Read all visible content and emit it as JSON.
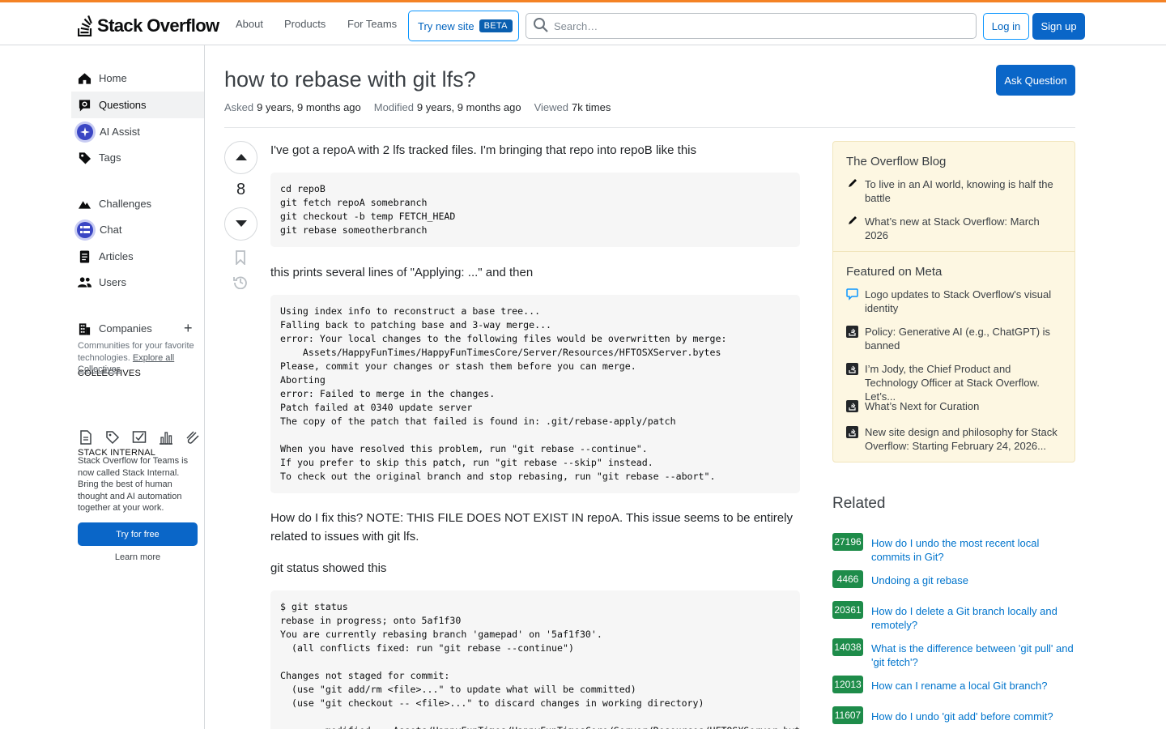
{
  "header": {
    "logo_text": "Stack Overflow",
    "nav": [
      "About",
      "Products",
      "For Teams"
    ],
    "try_new_label": "Try new site",
    "beta_label": "BETA",
    "search_placeholder": "Search…",
    "login_label": "Log in",
    "signup_label": "Sign up"
  },
  "sidebar": {
    "items": [
      {
        "label": "Home",
        "icon": "home-icon"
      },
      {
        "label": "Questions",
        "icon": "questions-icon",
        "active": true
      },
      {
        "label": "AI Assist",
        "icon": "ai-assist-icon"
      },
      {
        "label": "Tags",
        "icon": "tag-icon"
      },
      {
        "label": "Challenges",
        "icon": "challenges-icon"
      },
      {
        "label": "Chat",
        "icon": "chat-icon"
      },
      {
        "label": "Articles",
        "icon": "articles-icon"
      },
      {
        "label": "Users",
        "icon": "users-icon"
      },
      {
        "label": "Companies",
        "icon": "companies-icon"
      }
    ],
    "collectives_title": "COLLECTIVES",
    "collectives_desc": "Communities for your favorite technologies.",
    "collectives_link": "Explore all Collectives",
    "stack_internal_title": "STACK INTERNAL",
    "stack_internal_desc": "Stack Overflow for Teams is now called Stack Internal. Bring the best of human thought and AI automation together at your work.",
    "try_free_label": "Try for free",
    "learn_more_label": "Learn more"
  },
  "question": {
    "title": "how to rebase with git lfs?",
    "asked_label": "Asked",
    "asked_value": "9 years, 9 months ago",
    "modified_label": "Modified",
    "modified_value": "9 years, 9 months ago",
    "viewed_label": "Viewed",
    "viewed_value": "7k times",
    "ask_button": "Ask Question",
    "votes": "8",
    "p1": "I've got a repoA with 2 lfs tracked files. I'm bringing that repo into repoB like this",
    "code1": "cd repoB\ngit fetch repoA somebranch\ngit checkout -b temp FETCH_HEAD\ngit rebase someotherbranch",
    "p2": "this prints several lines of \"Applying: ...\" and then",
    "code2": "Using index info to reconstruct a base tree...\nFalling back to patching base and 3-way merge...\nerror: Your local changes to the following files would be overwritten by merge:\n    Assets/HappyFunTimes/HappyFunTimesCore/Server/Resources/HFTOSXServer.bytes\nPlease, commit your changes or stash them before you can merge.\nAborting\nerror: Failed to merge in the changes.\nPatch failed at 0340 update server\nThe copy of the patch that failed is found in: .git/rebase-apply/patch\n\nWhen you have resolved this problem, run \"git rebase --continue\".\nIf you prefer to skip this patch, run \"git rebase --skip\" instead.\nTo check out the original branch and stop rebasing, run \"git rebase --abort\".",
    "p3": "How do I fix this? NOTE: THIS FILE DOES NOT EXIST IN repoA. This issue seems to be entirely related to issues with git lfs.",
    "p4": "git status showed this",
    "code3": "$ git status\nrebase in progress; onto 5af1f30\nYou are currently rebasing branch 'gamepad' on '5af1f30'.\n  (all conflicts fixed: run \"git rebase --continue\")\n\nChanges not staged for commit:\n  (use \"git add/rm <file>...\" to update what will be committed)\n  (use \"git checkout -- <file>...\" to discard changes in working directory)\n\n        modified:   Assets/HappyFunTimes/HappyFunTimesCore/Server/Resources/HFTOSXServer.bytes"
  },
  "blog": {
    "title": "The Overflow Blog",
    "items": [
      "To live in an AI world, knowing is half the battle",
      "What’s new at Stack Overflow: March 2026"
    ]
  },
  "meta": {
    "title": "Featured on Meta",
    "items": [
      "Logo updates to Stack Overflow's visual identity",
      "Policy: Generative AI (e.g., ChatGPT) is banned",
      "I’m Jody, the Chief Product and Technology Officer at Stack Overflow. Let’s...",
      "What’s Next for Curation",
      "New site design and philosophy for Stack Overflow: Starting February 24, 2026..."
    ]
  },
  "related": {
    "title": "Related",
    "items": [
      {
        "score": "27196",
        "text": "How do I undo the most recent local commits in Git?"
      },
      {
        "score": "4466",
        "text": "Undoing a git rebase"
      },
      {
        "score": "20361",
        "text": "How do I delete a Git branch locally and remotely?"
      },
      {
        "score": "14038",
        "text": "What is the difference between 'git pull' and 'git fetch'?"
      },
      {
        "score": "12013",
        "text": "How can I rename a local Git branch?"
      },
      {
        "score": "11607",
        "text": "How do I undo 'git add' before commit?"
      }
    ]
  },
  "colors": {
    "accent": "#f48225",
    "primary": "#0a66c8",
    "link": "#0074cc",
    "answered": "#1e8c4a",
    "callout_bg": "#fdf7e2"
  }
}
